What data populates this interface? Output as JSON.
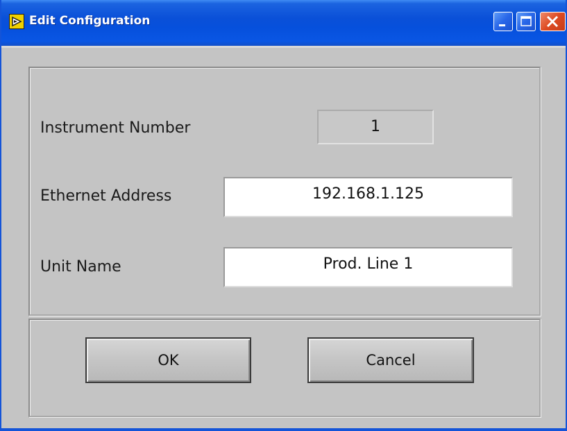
{
  "window": {
    "title": "Edit Configuration",
    "titlebar_color": "#0a50d8",
    "close_button_color": "#dd4a22",
    "background_color": "#c4c4c4"
  },
  "titlebar_buttons": {
    "minimize_icon": "minimize-icon",
    "maximize_icon": "maximize-icon",
    "close_icon": "close-icon"
  },
  "form": {
    "instrument_number_label": "Instrument Number",
    "instrument_number_value": "1",
    "ethernet_address_label": "Ethernet Address",
    "ethernet_address_value": "192.168.1.125",
    "unit_name_label": "Unit Name",
    "unit_name_value": "Prod. Line 1"
  },
  "buttons": {
    "ok_label": "OK",
    "cancel_label": "Cancel"
  }
}
